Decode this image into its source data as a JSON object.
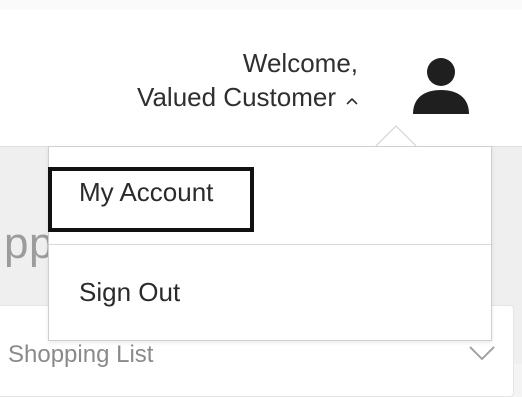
{
  "header": {
    "welcome_line1": "Welcome,",
    "welcome_line2": "Valued Customer",
    "chevron_icon": "chevron-up-icon",
    "avatar_icon": "user-avatar-icon"
  },
  "dropdown": {
    "items": [
      {
        "label": "My Account",
        "focused": true
      },
      {
        "label": "Sign Out"
      }
    ]
  },
  "background": {
    "heading_partial": "pp",
    "select_label": "Shopping List",
    "select_chevron_icon": "chevron-down-icon"
  },
  "colors": {
    "text": "#2f2f2f",
    "focus_outline": "#111111",
    "divider": "#d9d9d9",
    "background": "#efefef"
  }
}
